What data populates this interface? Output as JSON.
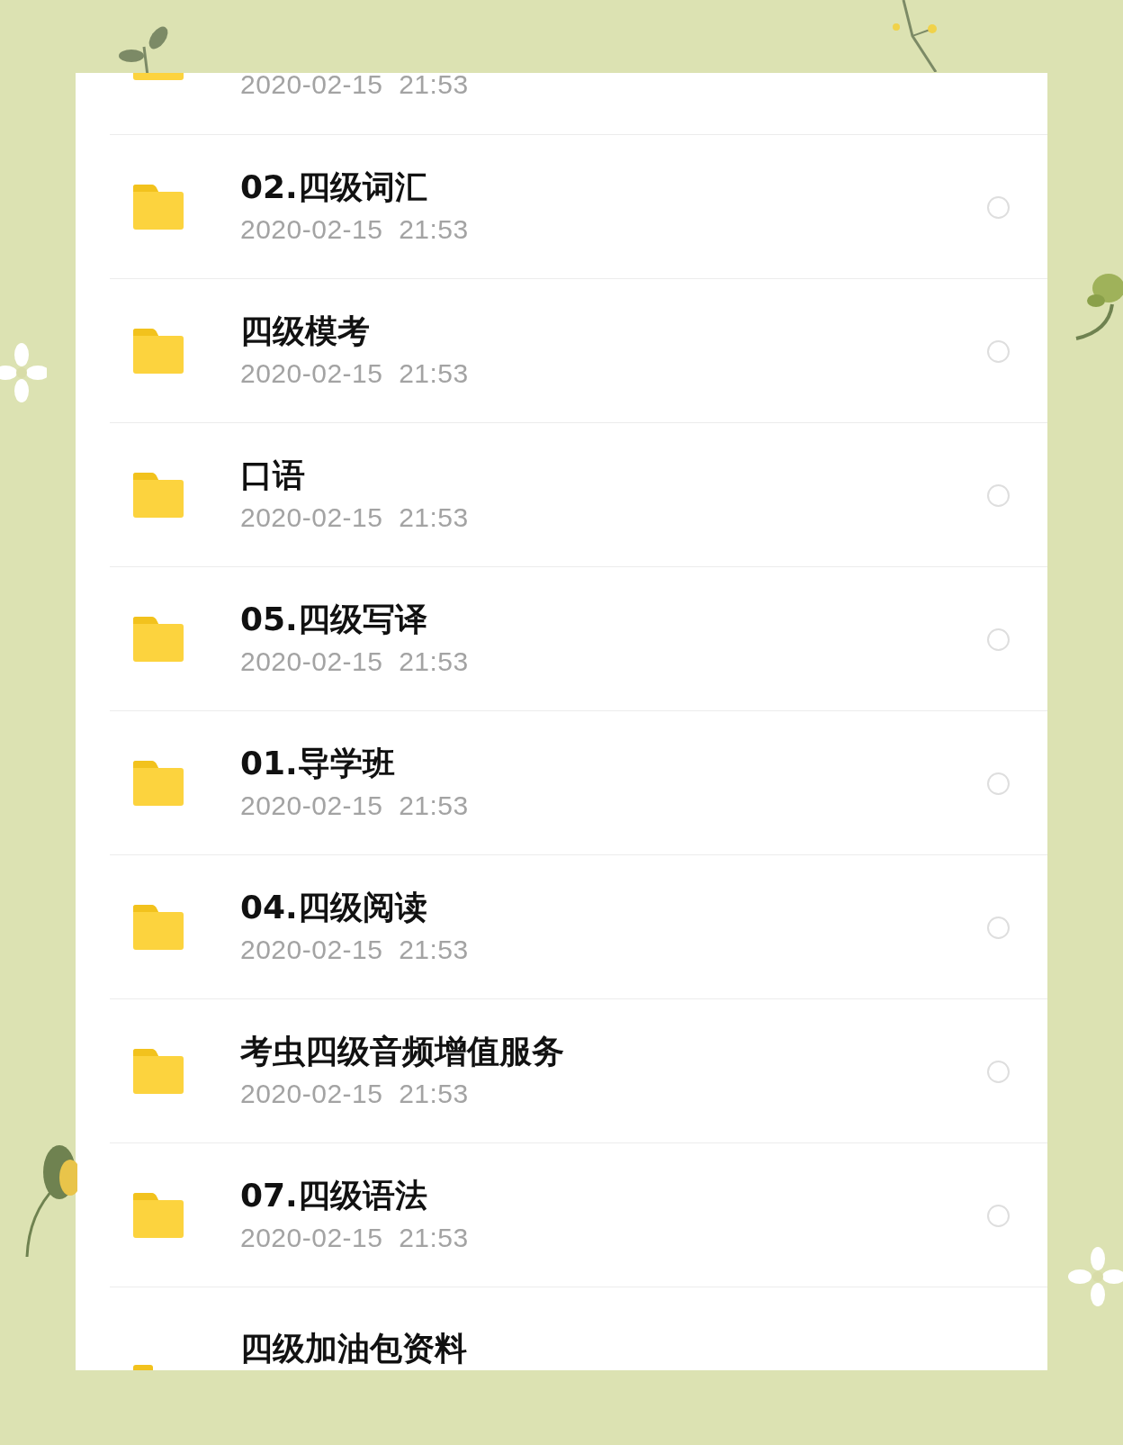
{
  "files": [
    {
      "kind": "top_cut",
      "date": "2020-02-15  21:53"
    },
    {
      "kind": "full",
      "title": "02.四级词汇",
      "date": "2020-02-15  21:53",
      "selected": false
    },
    {
      "kind": "full",
      "title": "四级模考",
      "date": "2020-02-15  21:53",
      "selected": false
    },
    {
      "kind": "full",
      "title": "口语",
      "date": "2020-02-15  21:53",
      "selected": false
    },
    {
      "kind": "full",
      "title": "05.四级写译",
      "date": "2020-02-15  21:53",
      "selected": false
    },
    {
      "kind": "full",
      "title": "01.导学班",
      "date": "2020-02-15  21:53",
      "selected": false
    },
    {
      "kind": "full",
      "title": "04.四级阅读",
      "date": "2020-02-15  21:53",
      "selected": false
    },
    {
      "kind": "full",
      "title": "考虫四级音频增值服务",
      "date": "2020-02-15  21:53",
      "selected": false
    },
    {
      "kind": "full",
      "title": "07.四级语法",
      "date": "2020-02-15  21:53",
      "selected": false
    },
    {
      "kind": "bottom_cut",
      "title": "四级加油包资料"
    }
  ]
}
